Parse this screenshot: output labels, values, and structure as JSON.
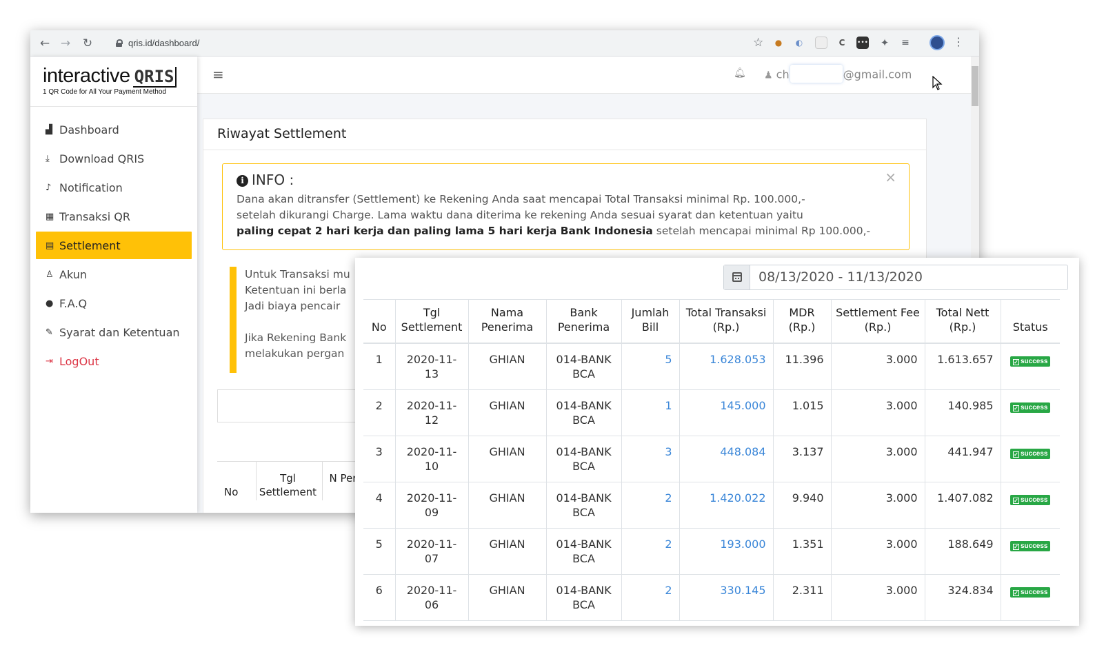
{
  "browser": {
    "url": "qris.id/dashboard/"
  },
  "logo": {
    "main": "interactive",
    "brand": "QRIS",
    "tagline": "1 QR Code for All Your Payment Method"
  },
  "sidebar": {
    "items": [
      {
        "label": "Dashboard",
        "icon": "chart-icon"
      },
      {
        "label": "Download QRIS",
        "icon": "download-icon"
      },
      {
        "label": "Notification",
        "icon": "bell-icon"
      },
      {
        "label": "Transaksi QR",
        "icon": "qrcode-icon"
      },
      {
        "label": "Settlement",
        "icon": "money-icon"
      },
      {
        "label": "Akun",
        "icon": "user-icon"
      },
      {
        "label": "F.A.Q",
        "icon": "chat-icon"
      },
      {
        "label": "Syarat dan Ketentuan",
        "icon": "edit-icon"
      },
      {
        "label": "LogOut",
        "icon": "logout-icon"
      }
    ]
  },
  "topnav": {
    "user_prefix": "ch",
    "user_suffix": "@gmail.com"
  },
  "page": {
    "title": "Riwayat Settlement",
    "info_heading": "INFO :",
    "info_line1": "Dana akan ditransfer (Settlement) ke Rekening Anda saat mencapai Total Transaksi minimal Rp. 100.000,-",
    "info_line2": "setelah dikurangi Charge. Lama waktu dana diterima ke rekening Anda sesuai syarat dan ketentuan yaitu",
    "info_bold": "paling cepat 2 hari kerja dan paling lama 5 hari kerja Bank Indonesia",
    "info_tail": " setelah mencapai minimal Rp 100.000,-",
    "note_lines": [
      "Untuk Transaksi mu",
      "Ketentuan ini berla",
      "Jadi biaya pencair",
      "",
      "Jika Rekening Bank",
      "melakukan pergan"
    ],
    "back_headers": [
      "No",
      "Tgl Settlement",
      "N Per"
    ]
  },
  "panel": {
    "date_range": "08/13/2020 - 11/13/2020",
    "headers": [
      "No",
      "Tgl Settlement",
      "Nama Penerima",
      "Bank Penerima",
      "Jumlah Bill",
      "Total Transaksi (Rp.)",
      "MDR (Rp.)",
      "Settlement Fee (Rp.)",
      "Total Nett (Rp.)",
      "Status"
    ],
    "rows": [
      {
        "no": "1",
        "tgl": "2020-11-13",
        "nama": "GHIAN",
        "bank": "014-BANK BCA",
        "bill": "5",
        "total": "1.628.053",
        "mdr": "11.396",
        "fee": "3.000",
        "nett": "1.613.657",
        "status": "success"
      },
      {
        "no": "2",
        "tgl": "2020-11-12",
        "nama": "GHIAN",
        "bank": "014-BANK BCA",
        "bill": "1",
        "total": "145.000",
        "mdr": "1.015",
        "fee": "3.000",
        "nett": "140.985",
        "status": "success"
      },
      {
        "no": "3",
        "tgl": "2020-11-10",
        "nama": "GHIAN",
        "bank": "014-BANK BCA",
        "bill": "3",
        "total": "448.084",
        "mdr": "3.137",
        "fee": "3.000",
        "nett": "441.947",
        "status": "success"
      },
      {
        "no": "4",
        "tgl": "2020-11-09",
        "nama": "GHIAN",
        "bank": "014-BANK BCA",
        "bill": "2",
        "total": "1.420.022",
        "mdr": "9.940",
        "fee": "3.000",
        "nett": "1.407.082",
        "status": "success"
      },
      {
        "no": "5",
        "tgl": "2020-11-07",
        "nama": "GHIAN",
        "bank": "014-BANK BCA",
        "bill": "2",
        "total": "193.000",
        "mdr": "1.351",
        "fee": "3.000",
        "nett": "188.649",
        "status": "success"
      },
      {
        "no": "6",
        "tgl": "2020-11-06",
        "nama": "GHIAN",
        "bank": "014-BANK BCA",
        "bill": "2",
        "total": "330.145",
        "mdr": "2.311",
        "fee": "3.000",
        "nett": "324.834",
        "status": "success"
      }
    ]
  },
  "colors": {
    "accent": "#ffc107",
    "link": "#3a86d8",
    "success": "#28a745",
    "logout": "#dc3545"
  }
}
